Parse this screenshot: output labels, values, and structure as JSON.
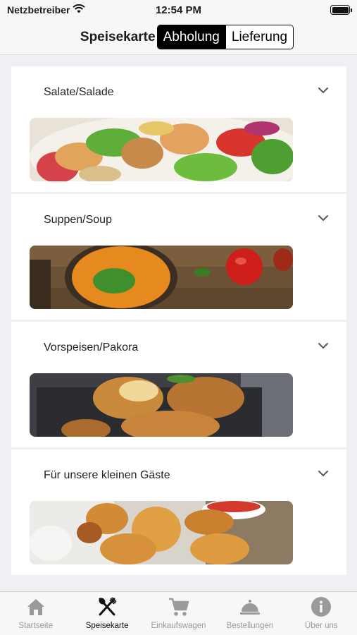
{
  "status_bar": {
    "carrier": "Netzbetreiber",
    "time": "12:54 PM",
    "icons": [
      "wifi-icon",
      "battery-icon"
    ]
  },
  "header": {
    "title": "Speisekarte",
    "segments": [
      {
        "label": "Abholung",
        "selected": true
      },
      {
        "label": "Lieferung",
        "selected": false
      }
    ]
  },
  "categories": [
    {
      "title": "Salate/Salade",
      "icon": "chevron-down-icon",
      "image": "salad-image"
    },
    {
      "title": "Suppen/Soup",
      "icon": "chevron-down-icon",
      "image": "soup-image"
    },
    {
      "title": "Vorspeisen/Pakora",
      "icon": "chevron-down-icon",
      "image": "pakora-image"
    },
    {
      "title": "Für unsere kleinen Gäste",
      "icon": "chevron-down-icon",
      "image": "nuggets-image"
    }
  ],
  "tab_bar": {
    "items": [
      {
        "label": "Startseite",
        "icon": "home-icon",
        "active": false
      },
      {
        "label": "Speisekarte",
        "icon": "fork-knife-icon",
        "active": true
      },
      {
        "label": "Einkaufswagen",
        "icon": "cart-icon",
        "active": false
      },
      {
        "label": "Bestellungen",
        "icon": "cloche-icon",
        "active": false
      },
      {
        "label": "Über uns",
        "icon": "info-icon",
        "active": false
      }
    ]
  },
  "colors": {
    "background": "#efeff4",
    "active_segment": "#000000",
    "tab_active": "#111111",
    "tab_inactive": "#9a9a9a"
  }
}
